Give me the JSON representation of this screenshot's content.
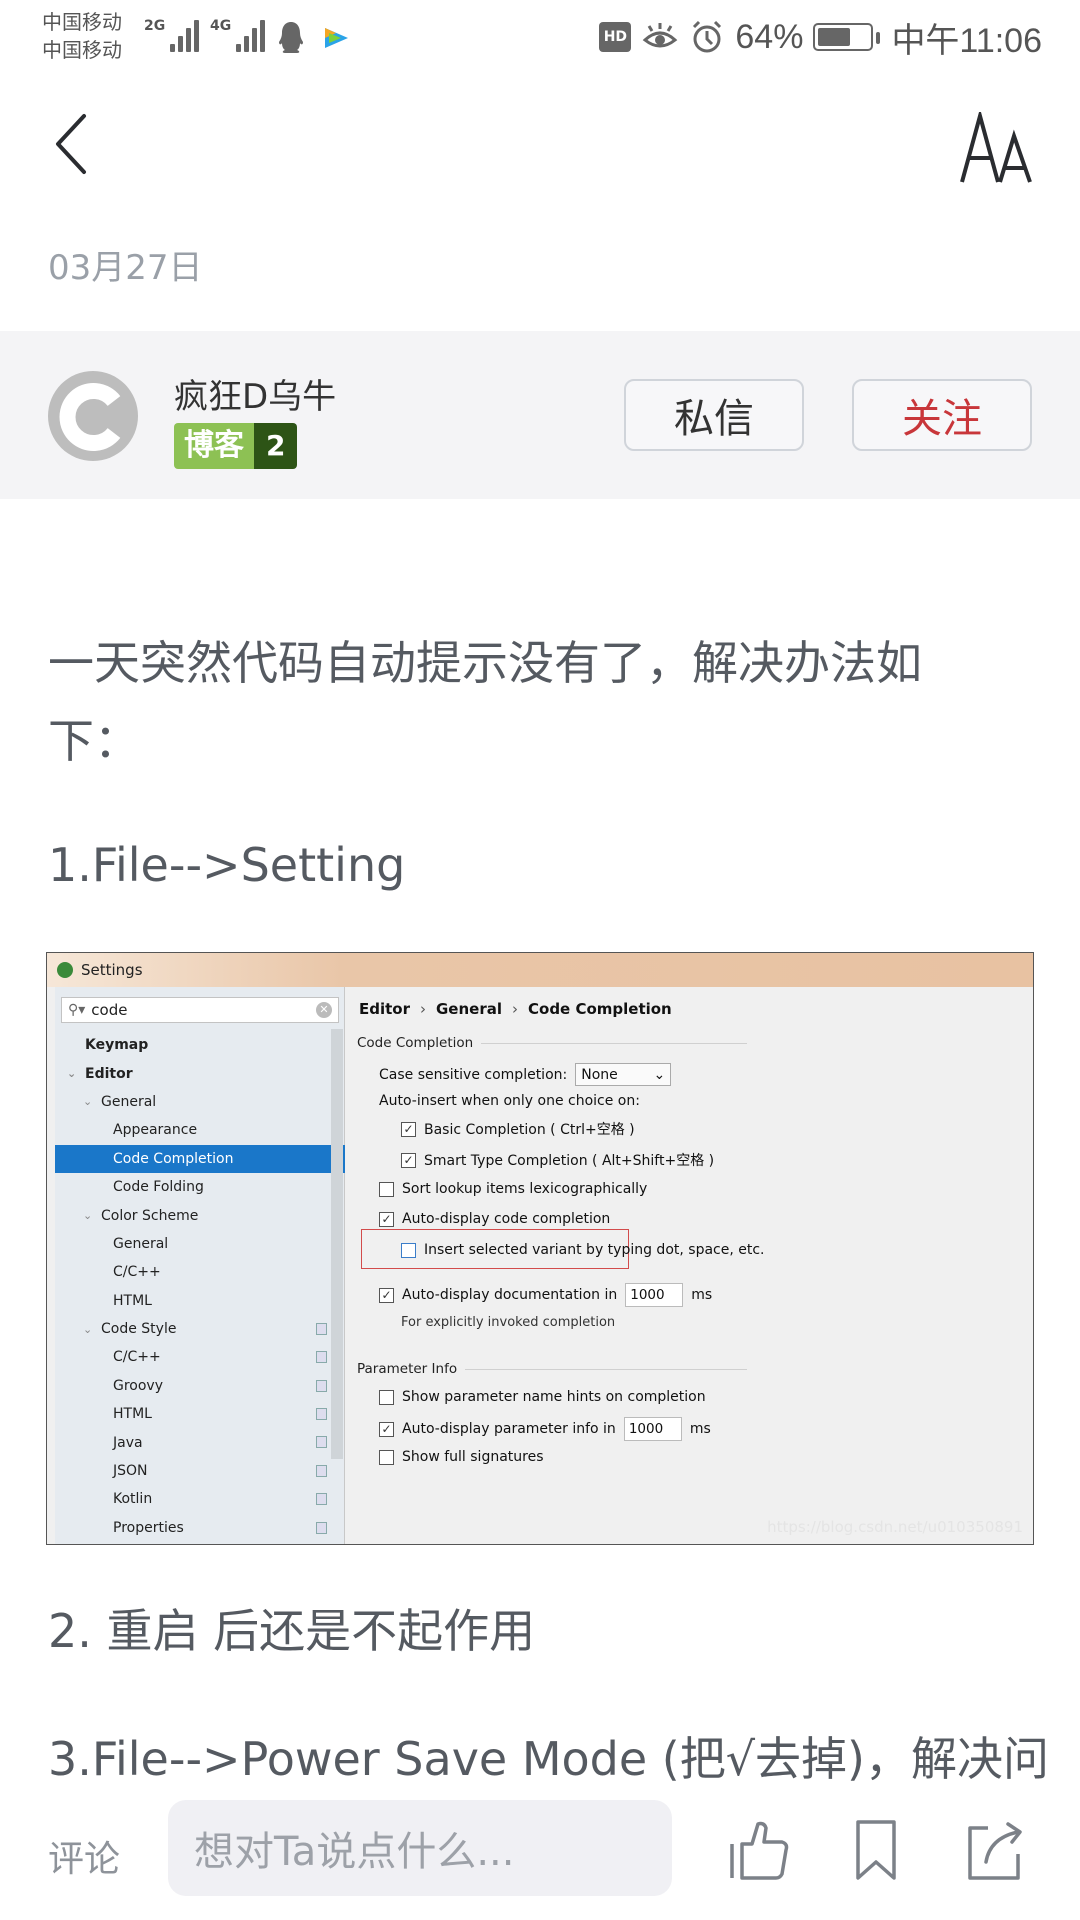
{
  "status_bar": {
    "carrier_1": "中国移动",
    "carrier_2": "中国移动",
    "network_1": "2G",
    "network_2": "4G",
    "icons": [
      "signal-icon",
      "qq-icon",
      "tencent-video-icon",
      "hd-icon",
      "eye-comfort-icon",
      "alarm-icon",
      "battery-icon"
    ],
    "hd_label": "HD",
    "battery_percent": "64%",
    "battery_level": 0.64,
    "time": "中午11:06"
  },
  "header": {
    "back_icon": "chevron-left-icon",
    "font_size_icon": "font-size-icon",
    "date": "03月27日"
  },
  "author": {
    "name": "疯狂D乌牛",
    "badge_label": "博客",
    "badge_level": "2",
    "message_button": "私信",
    "follow_button": "关注",
    "follow_color": "#c8363a"
  },
  "article": {
    "paragraph_1": "一天突然代码自动提示没有了，解决办法如下：",
    "paragraph_2": "1.File-->Setting",
    "paragraph_3": "2. 重启 后还是不起作用",
    "paragraph_4": "3.File-->Power Save Mode (把√去掉)，解决问"
  },
  "settings_screenshot": {
    "window_title": "Settings",
    "search_value": "code",
    "tree": [
      {
        "label": "Keymap",
        "level": 0,
        "bold": true,
        "expandable": false
      },
      {
        "label": "Editor",
        "level": 0,
        "bold": true,
        "expandable": true
      },
      {
        "label": "General",
        "level": 1,
        "expandable": true
      },
      {
        "label": "Appearance",
        "level": 2
      },
      {
        "label": "Code Completion",
        "level": 2,
        "selected": true
      },
      {
        "label": "Code Folding",
        "level": 2
      },
      {
        "label": "Color Scheme",
        "level": 1,
        "expandable": true
      },
      {
        "label": "General",
        "level": 2
      },
      {
        "label": "C/C++",
        "level": 2
      },
      {
        "label": "HTML",
        "level": 2
      },
      {
        "label": "Code Style",
        "level": 1,
        "expandable": true,
        "copy": true
      },
      {
        "label": "C/C++",
        "level": 2,
        "copy": true
      },
      {
        "label": "Groovy",
        "level": 2,
        "copy": true
      },
      {
        "label": "HTML",
        "level": 2,
        "copy": true
      },
      {
        "label": "Java",
        "level": 2,
        "copy": true
      },
      {
        "label": "JSON",
        "level": 2,
        "copy": true
      },
      {
        "label": "Kotlin",
        "level": 2,
        "copy": true
      },
      {
        "label": "Properties",
        "level": 2,
        "copy": true
      }
    ],
    "breadcrumb": [
      "Editor",
      "General",
      "Code Completion"
    ],
    "breadcrumb_sep": "›",
    "group_code_completion": "Code Completion",
    "case_sensitive_label": "Case sensitive completion:",
    "case_sensitive_value": "None",
    "auto_insert_label": "Auto-insert when only one choice on:",
    "basic_completion": {
      "label": "Basic Completion ( Ctrl+空格 )",
      "checked": true
    },
    "smart_completion": {
      "label": "Smart Type Completion ( Alt+Shift+空格 )",
      "checked": true
    },
    "sort_lookup": {
      "label": "Sort lookup items lexicographically",
      "checked": false
    },
    "auto_display": {
      "label": "Auto-display code completion",
      "checked": true
    },
    "insert_selected": {
      "label": "Insert selected variant by typing dot, space, etc.",
      "checked": false
    },
    "auto_doc": {
      "label": "Auto-display documentation in",
      "checked": true,
      "value": "1000",
      "unit": "ms"
    },
    "auto_doc_hint": "For explicitly invoked completion",
    "group_parameter_info": "Parameter Info",
    "param_hints": {
      "label": "Show parameter name hints on completion",
      "checked": false
    },
    "param_info": {
      "label": "Auto-display parameter info in",
      "checked": true,
      "value": "1000",
      "unit": "ms"
    },
    "full_signatures": {
      "label": "Show full signatures",
      "checked": false
    },
    "watermark": "https://blog.csdn.net/u010350891",
    "check_mark": "✓"
  },
  "bottom_bar": {
    "comment_label": "评论",
    "comment_placeholder": "想对Ta说点什么...",
    "icons": [
      "thumbs-up-icon",
      "bookmark-icon",
      "share-icon"
    ]
  }
}
